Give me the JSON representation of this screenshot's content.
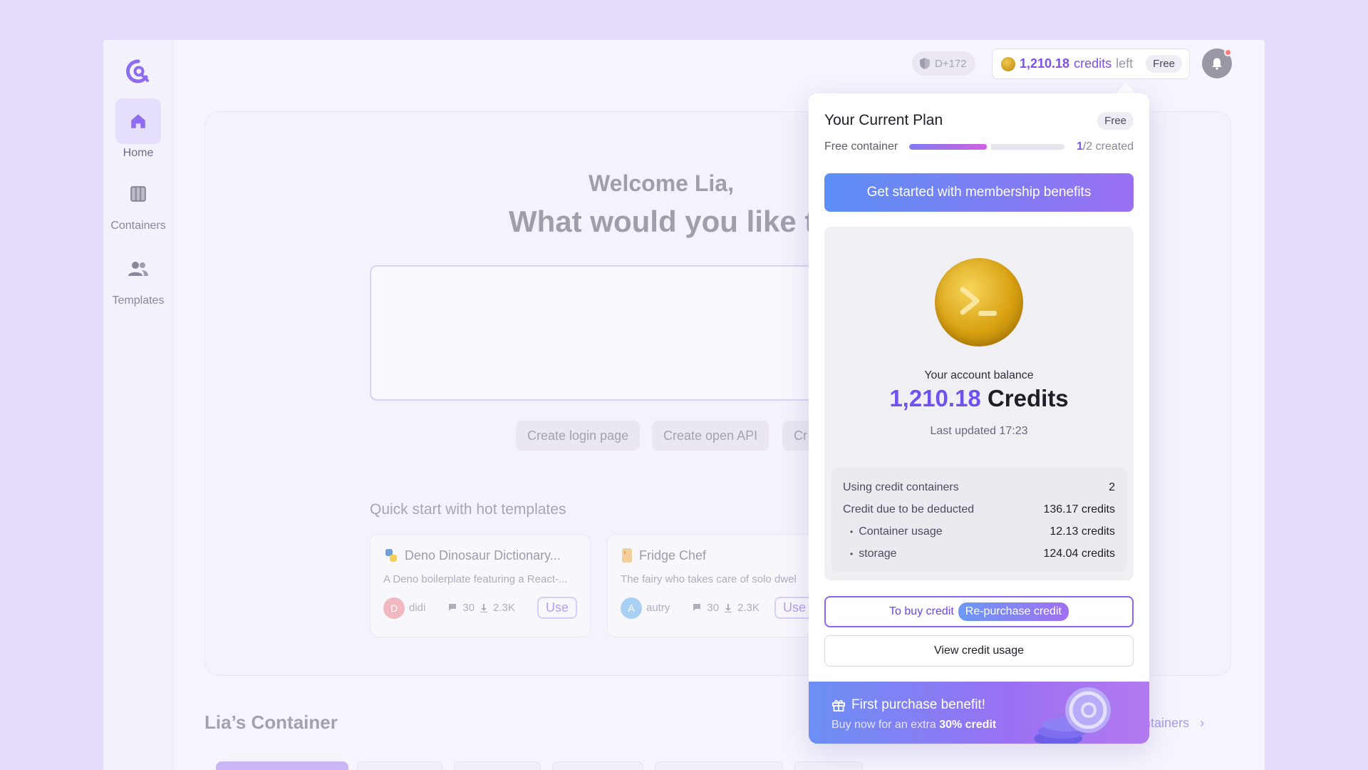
{
  "sidebar": {
    "items": [
      {
        "label": "Home",
        "icon": "home-icon"
      },
      {
        "label": "Containers",
        "icon": "columns-icon"
      },
      {
        "label": "Templates",
        "icon": "users-icon"
      }
    ]
  },
  "topbar": {
    "shield_text": "D+172",
    "credits_amount": "1,210.18",
    "credits_unit": "credits",
    "credits_suffix": "left",
    "plan_tag": "Free"
  },
  "main": {
    "welcome": "Welcome Lia,",
    "headline": "What would you like t",
    "chips": [
      "Create login page",
      "Create open API",
      "Cr"
    ],
    "quick_title": "Quick start with hot templates",
    "templates": [
      {
        "title": "Deno Dinosaur Dictionary...",
        "desc": "A Deno boilerplate featuring a React-...",
        "author": "didi",
        "initial": "D",
        "comments": "30",
        "downloads": "2.3K",
        "use_label": "Use"
      },
      {
        "title": "Fridge Chef",
        "desc": "The fairy who takes care of solo dwel",
        "author": "autry",
        "initial": "A",
        "comments": "30",
        "downloads": "2.3K",
        "use_label": "Use"
      }
    ],
    "section_title": "Lia’s Container",
    "see_all": "ntainers"
  },
  "popover": {
    "title": "Your Current Plan",
    "plan_tag": "Free",
    "container_label": "Free container",
    "created_count": "1",
    "created_rest": "/2 created",
    "container_fraction": 0.5,
    "cta_label": "Get started with membership benefits",
    "balance_label": "Your account balance",
    "balance_amount": "1,210.18",
    "balance_unit": "Credits",
    "last_updated": "Last updated 17:23",
    "details": [
      {
        "label": "Using credit containers",
        "value": "2"
      },
      {
        "label": "Credit due to be deducted",
        "value": "136.17 credits"
      },
      {
        "label": "Container usage",
        "value": "12.13 credits"
      },
      {
        "label": "storage",
        "value": "124.04 credits"
      }
    ],
    "buy_label": "To buy credit",
    "repurchase_label": "Re-purchase credit",
    "view_usage_label": "View credit usage",
    "promo_title": "First purchase benefit!",
    "promo_prefix": "Buy now for an extra ",
    "promo_bold": "30% credit"
  },
  "colors": {
    "accent": "#7050f0",
    "cta_start": "#5c8ff5",
    "cta_end": "#9a6ff2",
    "background": "#e4dcfa"
  }
}
